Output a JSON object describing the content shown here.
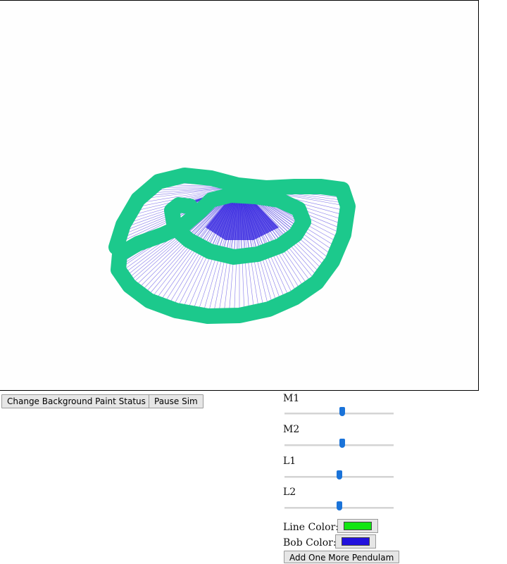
{
  "buttons": {
    "background_paint": "Change Background Paint Status",
    "pause": "Pause Sim",
    "add_pendulum": "Add One More Pendulam"
  },
  "sliders": [
    {
      "label": "M1",
      "value": 0.53
    },
    {
      "label": "M2",
      "value": 0.53
    },
    {
      "label": "L1",
      "value": 0.5
    },
    {
      "label": "L2",
      "value": 0.5
    }
  ],
  "colors": {
    "line_label": "Line Color:",
    "line_color": "#12e612",
    "bob_label": "Bob Color:",
    "bob_color": "#2211dd",
    "trail_color": "#1cc98c"
  }
}
